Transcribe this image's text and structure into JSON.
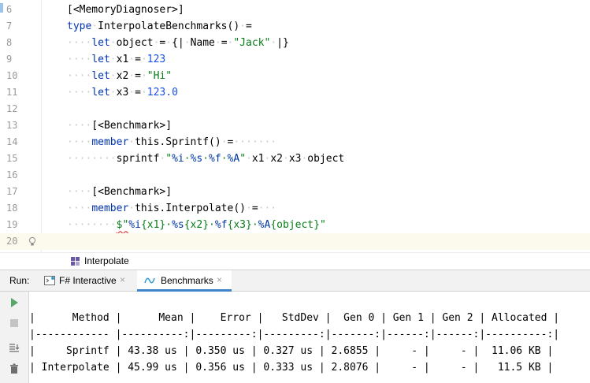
{
  "editor": {
    "lines": [
      {
        "num": "6",
        "html": "<span class=\"attr\">[&lt;MemoryDiagnoser&gt;]</span>"
      },
      {
        "num": "7",
        "html": "<span class=\"kw\">type</span><span class=\"dot\">·</span>InterpolateBenchmarks()<span class=\"dot\">·</span>="
      },
      {
        "num": "8",
        "html": "<span class=\"dot\">····</span><span class=\"kw\">let</span><span class=\"dot\">·</span>object<span class=\"dot\">·</span>=<span class=\"dot\">·</span>{|<span class=\"dot\">·</span>Name<span class=\"dot\">·</span>=<span class=\"dot\">·</span><span class=\"str\">\"Jack\"</span><span class=\"dot\">·</span>|}"
      },
      {
        "num": "9",
        "html": "<span class=\"dot\">····</span><span class=\"kw\">let</span><span class=\"dot\">·</span>x1<span class=\"dot\">·</span>=<span class=\"dot\">·</span><span class=\"num\">123</span>"
      },
      {
        "num": "10",
        "html": "<span class=\"dot\">····</span><span class=\"kw\">let</span><span class=\"dot\">·</span>x2<span class=\"dot\">·</span>=<span class=\"dot\">·</span><span class=\"str\">\"Hi\"</span>"
      },
      {
        "num": "11",
        "html": "<span class=\"dot\">····</span><span class=\"kw\">let</span><span class=\"dot\">·</span>x3<span class=\"dot\">·</span>=<span class=\"dot\">·</span><span class=\"num\">123.0</span>"
      },
      {
        "num": "12",
        "html": ""
      },
      {
        "num": "13",
        "html": "<span class=\"dot\">····</span>[&lt;Benchmark&gt;]"
      },
      {
        "num": "14",
        "html": "<span class=\"dot\">····</span><span class=\"kw\">member</span><span class=\"dot\">·</span>this.Sprintf()<span class=\"dot\">·</span>=<span class=\"dot\">·······</span>"
      },
      {
        "num": "15",
        "html": "<span class=\"dot\">········</span>sprintf<span class=\"dot\">·</span><span class=\"str\">\"<span class=\"ph\">%i</span>·<span class=\"ph\">%s</span>·<span class=\"ph\">%f</span>·<span class=\"ph\">%A</span>\"</span><span class=\"dot\">·</span>x1<span class=\"dot\">·</span>x2<span class=\"dot\">·</span>x3<span class=\"dot\">·</span>object"
      },
      {
        "num": "16",
        "html": ""
      },
      {
        "num": "17",
        "html": "<span class=\"dot\">····</span>[&lt;Benchmark&gt;]"
      },
      {
        "num": "18",
        "html": "<span class=\"dot\">····</span><span class=\"kw\">member</span><span class=\"dot\">·</span>this.Interpolate()<span class=\"dot\">·</span>=<span class=\"dot\">···</span>"
      },
      {
        "num": "19",
        "html": "<span class=\"dot\">········</span><span class=\"str\"><span class=\"sq\">$\"</span><span class=\"ph\">%i</span>{x1}·<span class=\"ph\">%s</span>{x2}·<span class=\"ph\">%f</span>{x3}·<span class=\"ph\">%A</span>{object}\"</span>"
      },
      {
        "num": "20",
        "html": ""
      }
    ]
  },
  "breadcrumb": {
    "label": "Interpolate"
  },
  "run": {
    "label": "Run:",
    "tabs": [
      {
        "label": "F# Interactive",
        "close": "×",
        "active": false
      },
      {
        "label": "Benchmarks",
        "close": "×",
        "active": true
      }
    ]
  },
  "console": {
    "lines": [
      "|      Method |      Mean |    Error |   StdDev |  Gen 0 | Gen 1 | Gen 2 | Allocated |",
      "|------------ |----------:|---------:|---------:|-------:|------:|------:|----------:|",
      "|     Sprintf | 43.38 us | 0.350 us | 0.327 us | 2.6855 |     - |     - |  11.06 KB |",
      "| Interpolate | 45.99 us | 0.356 us | 0.333 us | 2.8076 |     - |     - |   11.5 KB |"
    ]
  },
  "icons": {
    "run": "run-icon",
    "stop": "stop-icon",
    "scroll": "scroll-to-end-icon",
    "trash": "trash-icon",
    "bulb": "lightbulb-icon",
    "struct": "structure-icon"
  },
  "colors": {
    "keyword": "#0033b3",
    "string": "#067d17",
    "number": "#1750eb",
    "active_tab": "#4083c9"
  }
}
